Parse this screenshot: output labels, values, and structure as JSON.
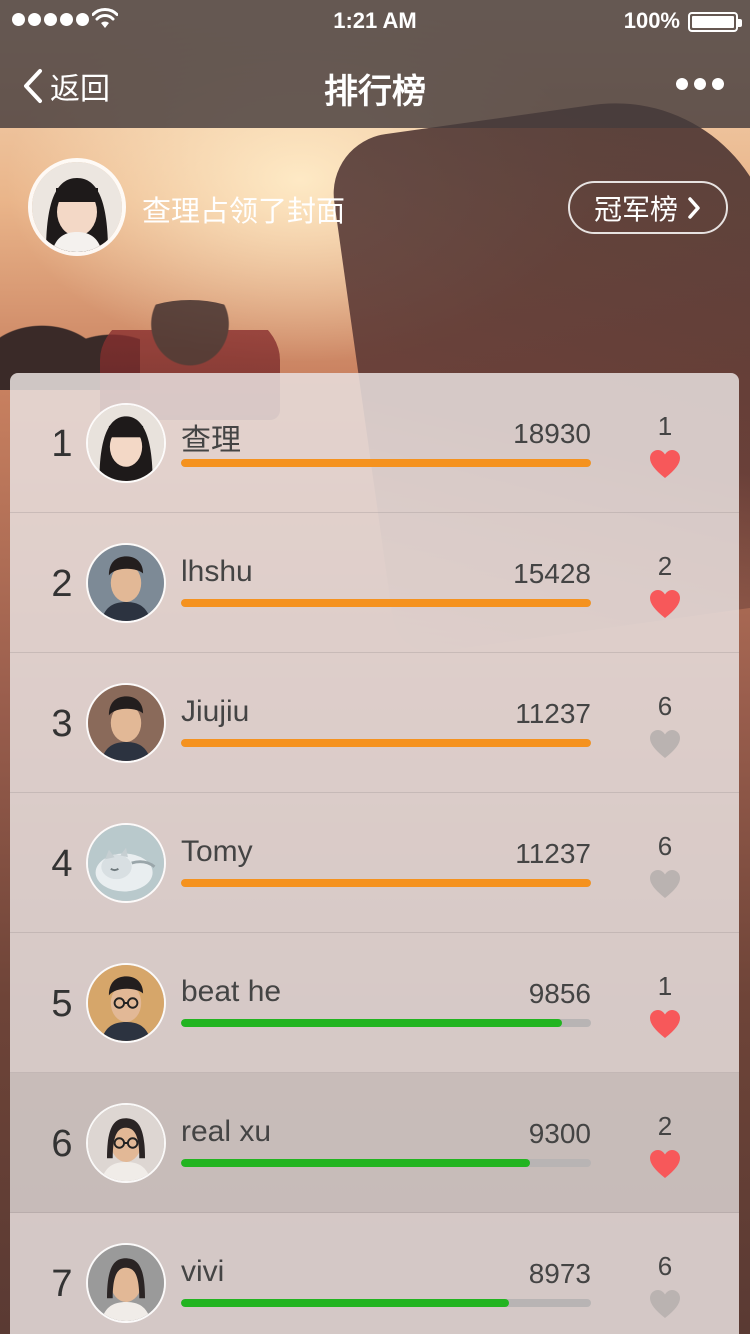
{
  "status_bar": {
    "time": "1:21 AM",
    "battery": "100%"
  },
  "nav": {
    "back_label": "返回",
    "title": "排行榜",
    "more_icon": "more-dots-icon"
  },
  "cover": {
    "text": "查理占领了封面",
    "champion_label": "冠军榜"
  },
  "colors": {
    "orange_bar": "#f5921e",
    "green_bar": "#22b420",
    "heart_liked": "#f7585a",
    "heart_default": "#bab3b1"
  },
  "ranking": [
    {
      "rank": "1",
      "name": "查理",
      "score": "18930",
      "likes": "1",
      "liked": true,
      "bar_color": "orange",
      "progress": 1.0,
      "avatar_icon": "avatar-girl-icon",
      "avatar_bg": "#e8e2dc"
    },
    {
      "rank": "2",
      "name": "lhshu",
      "score": "15428",
      "likes": "2",
      "liked": true,
      "bar_color": "orange",
      "progress": 1.0,
      "avatar_icon": "avatar-man-icon",
      "avatar_bg": "#7d8a96"
    },
    {
      "rank": "3",
      "name": "Jiujiu",
      "score": "11237",
      "likes": "6",
      "liked": false,
      "bar_color": "orange",
      "progress": 1.0,
      "avatar_icon": "avatar-man-icon",
      "avatar_bg": "#8a6a5a"
    },
    {
      "rank": "4",
      "name": "Tomy",
      "score": "11237",
      "likes": "6",
      "liked": false,
      "bar_color": "orange",
      "progress": 1.0,
      "avatar_icon": "avatar-cat-icon",
      "avatar_bg": "#b9c9cc"
    },
    {
      "rank": "5",
      "name": "beat he",
      "score": "9856",
      "likes": "1",
      "liked": true,
      "bar_color": "green",
      "progress": 0.93,
      "avatar_icon": "avatar-man-glasses-icon",
      "avatar_bg": "#d6a66a"
    },
    {
      "rank": "6",
      "name": "real xu",
      "score": "9300",
      "likes": "2",
      "liked": true,
      "bar_color": "green",
      "progress": 0.85,
      "avatar_icon": "avatar-woman-glasses-icon",
      "avatar_bg": "#ddd6d2"
    },
    {
      "rank": "7",
      "name": "vivi",
      "score": "8973",
      "likes": "6",
      "liked": false,
      "bar_color": "green",
      "progress": 0.8,
      "avatar_icon": "avatar-woman-icon",
      "avatar_bg": "#9a9a9a"
    }
  ]
}
